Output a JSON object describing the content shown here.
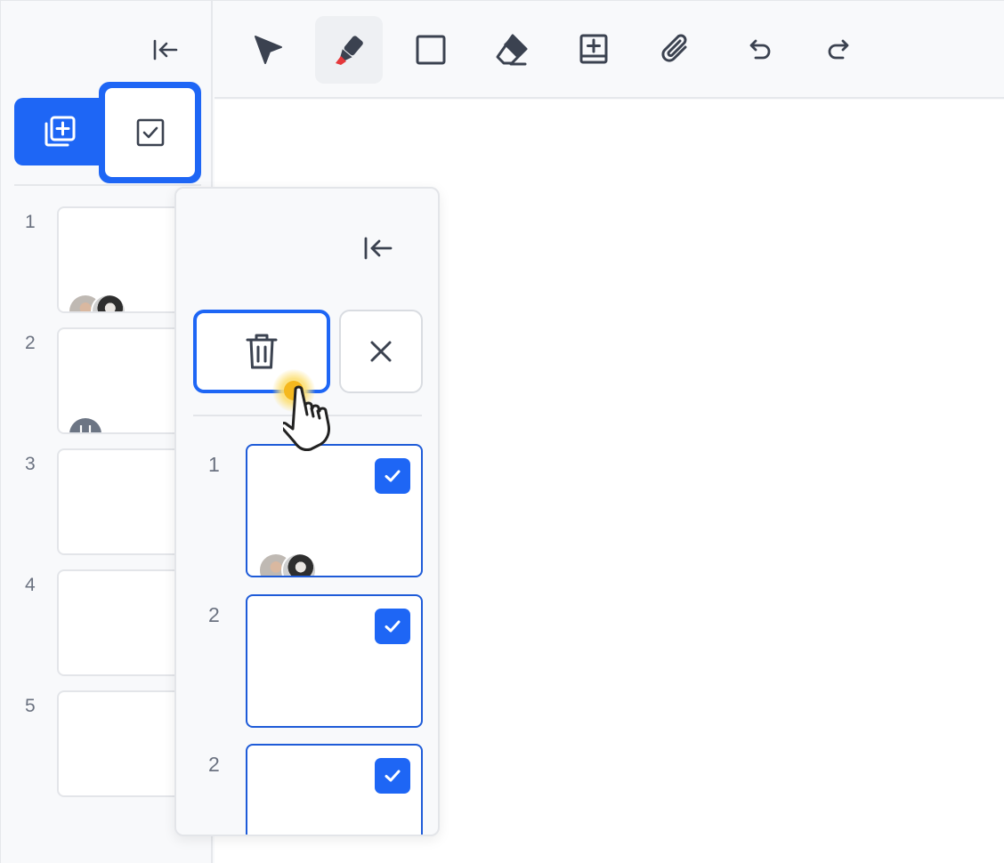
{
  "sidebar": {
    "collapse_icon": "collapse-left-icon",
    "add_page_icon": "add-page-icon",
    "select_mode_icon": "checkbox-icon",
    "pages": [
      {
        "number": "1",
        "avatars": [
          "photo",
          "photo"
        ]
      },
      {
        "number": "2",
        "avatars": [
          "grey"
        ]
      },
      {
        "number": "3",
        "avatars": []
      },
      {
        "number": "4",
        "avatars": []
      },
      {
        "number": "5",
        "avatars": []
      }
    ]
  },
  "toolbar": {
    "tools": [
      {
        "name": "select-tool",
        "icon": "pointer-arrow-icon",
        "active": false
      },
      {
        "name": "pen-tool",
        "icon": "marker-pen-icon",
        "active": true
      },
      {
        "name": "shape-tool",
        "icon": "square-icon",
        "active": false
      },
      {
        "name": "eraser-tool",
        "icon": "eraser-icon",
        "active": false
      },
      {
        "name": "add-note-tool",
        "icon": "add-box-icon",
        "active": false
      },
      {
        "name": "attach-tool",
        "icon": "paperclip-icon",
        "active": false
      },
      {
        "name": "undo-tool",
        "icon": "undo-icon",
        "active": false
      },
      {
        "name": "redo-tool",
        "icon": "redo-icon",
        "active": false
      }
    ]
  },
  "selection_panel": {
    "delete_icon": "trash-icon",
    "close_icon": "close-icon",
    "pages": [
      {
        "number": "1",
        "checked": true,
        "avatars": [
          "photo",
          "photo"
        ]
      },
      {
        "number": "2",
        "checked": true,
        "avatars": []
      },
      {
        "number": "2",
        "checked": true,
        "avatars": []
      }
    ]
  },
  "colors": {
    "accent": "#1e66f5",
    "pen_red": "#e5383b",
    "icon": "#3b4250",
    "background": "#f8f9fb"
  }
}
